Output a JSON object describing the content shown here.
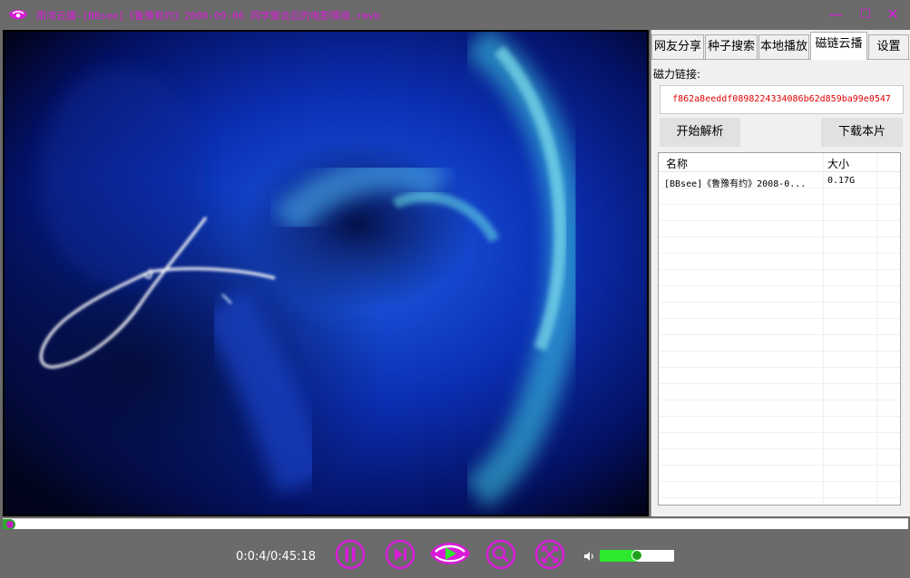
{
  "window": {
    "title": "雨湾云播-[BBsee]《鲁豫有约》2008-09-06  同学聚会后的电影情缘.rmvb",
    "controls": {
      "minimize": "—",
      "maximize": "☐",
      "close": "✕"
    }
  },
  "panel": {
    "tabs": [
      {
        "label": "网友分享",
        "active": false
      },
      {
        "label": "种子搜索",
        "active": false
      },
      {
        "label": "本地播放",
        "active": false
      },
      {
        "label": "磁链云播",
        "active": true
      },
      {
        "label": "设置",
        "active": false
      }
    ],
    "magnet_label": "磁力链接:",
    "magnet_value": "f862a8eeddf0898224334086b62d859ba99e0547",
    "parse_button": "开始解析",
    "download_button": "下载本片",
    "list": {
      "columns": [
        "名称",
        "大小"
      ],
      "rows": [
        {
          "name": "[BBsee]《鲁豫有约》2008-0...",
          "size": "0.17G"
        }
      ]
    }
  },
  "player": {
    "progress": 0.002,
    "time": "0:0:4/0:45:18",
    "volume": 0.5,
    "icons": [
      "pause-icon",
      "next-icon",
      "logo-play-icon",
      "search-icon",
      "fullscreen-icon",
      "volume-icon"
    ]
  },
  "colors": {
    "accent": "#d91bd9",
    "green": "#2ea82e",
    "magnet_text": "#e00000"
  }
}
